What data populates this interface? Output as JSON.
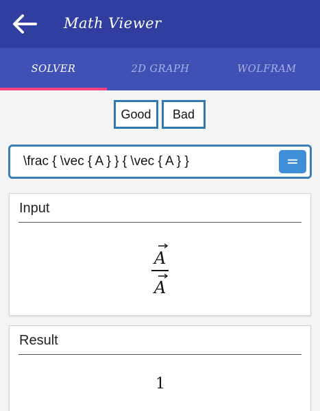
{
  "app_bar": {
    "title": "Math Viewer",
    "back_icon": "arrow-left-icon",
    "color": "#303f9f"
  },
  "tabs": [
    {
      "label": "SOLVER",
      "active": true
    },
    {
      "label": "2D GRAPH",
      "active": false
    },
    {
      "label": "WOLFRAM",
      "active": false
    }
  ],
  "tab_indicator_color": "#ff4081",
  "feedback": {
    "good_label": "Good",
    "bad_label": "Bad"
  },
  "expression_input": {
    "value": "\\frac { \\vec { A } } { \\vec { A } }",
    "submit_label": "="
  },
  "input_card": {
    "title": "Input",
    "numerator": "A",
    "denominator": "A"
  },
  "result_card": {
    "title": "Result",
    "value": "1"
  }
}
